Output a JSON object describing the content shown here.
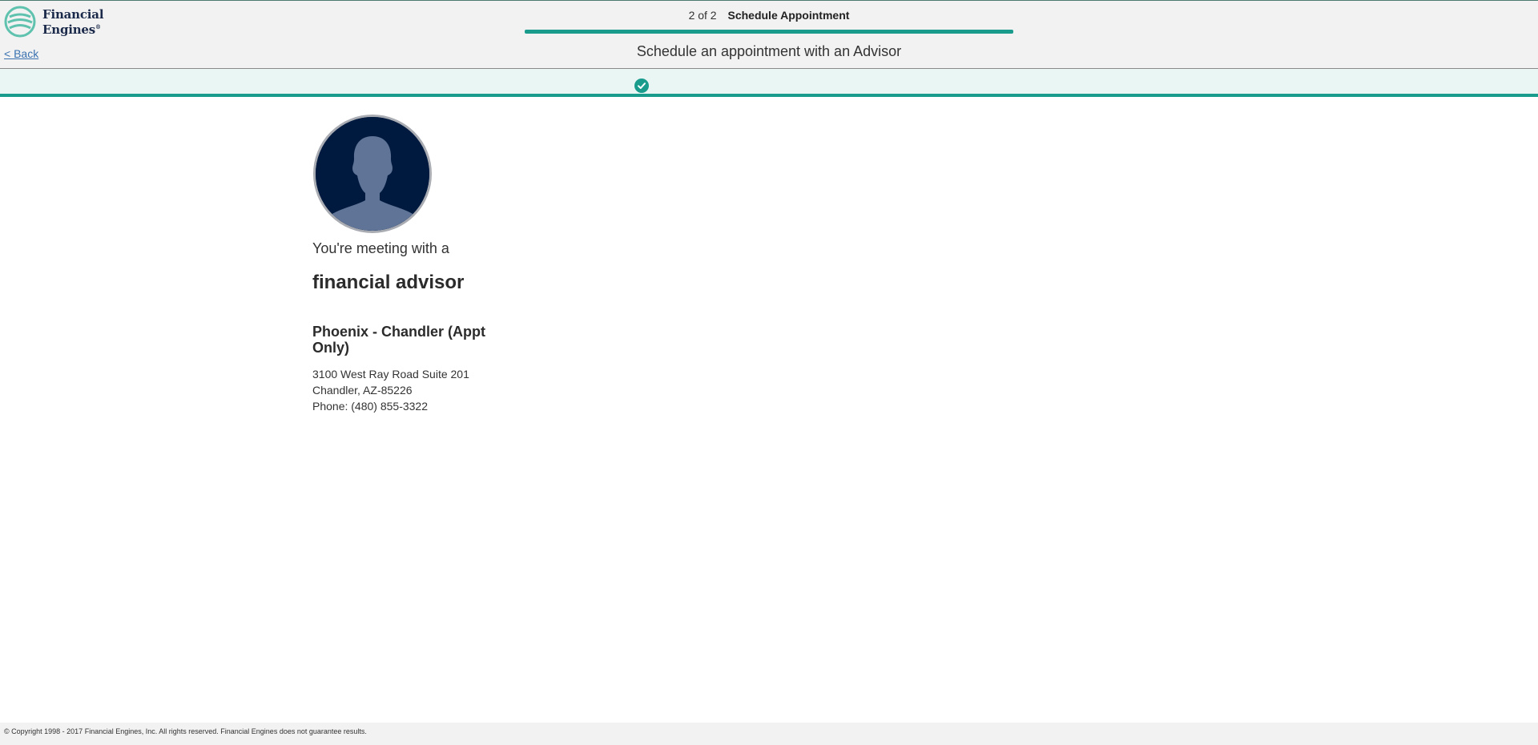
{
  "brand": {
    "name_line1": "Financial",
    "name_line2": "Engines",
    "registered_mark": "®",
    "accent_color": "#1a9c8c",
    "navy_color": "#1b2a4a"
  },
  "nav": {
    "back_label": "< Back"
  },
  "progress": {
    "step_count": "2 of 2",
    "step_name": "Schedule Appointment",
    "completion": 1.0
  },
  "page": {
    "heading": "Schedule an appointment with an Advisor",
    "confirmation_icon": "check-circle-icon"
  },
  "advisor": {
    "avatar_icon": "person-silhouette-icon",
    "intro": "You're meeting with a",
    "role": "financial advisor"
  },
  "office": {
    "name": "Phoenix - Chandler (Appt Only)",
    "address_line1": "3100 West Ray Road Suite 201",
    "address_line2": "Chandler, AZ-85226",
    "phone": "Phone: (480) 855-3322"
  },
  "footer": {
    "copyright": "© Copyright 1998 - 2017 Financial Engines, Inc. All rights reserved. Financial Engines does not guarantee results."
  }
}
